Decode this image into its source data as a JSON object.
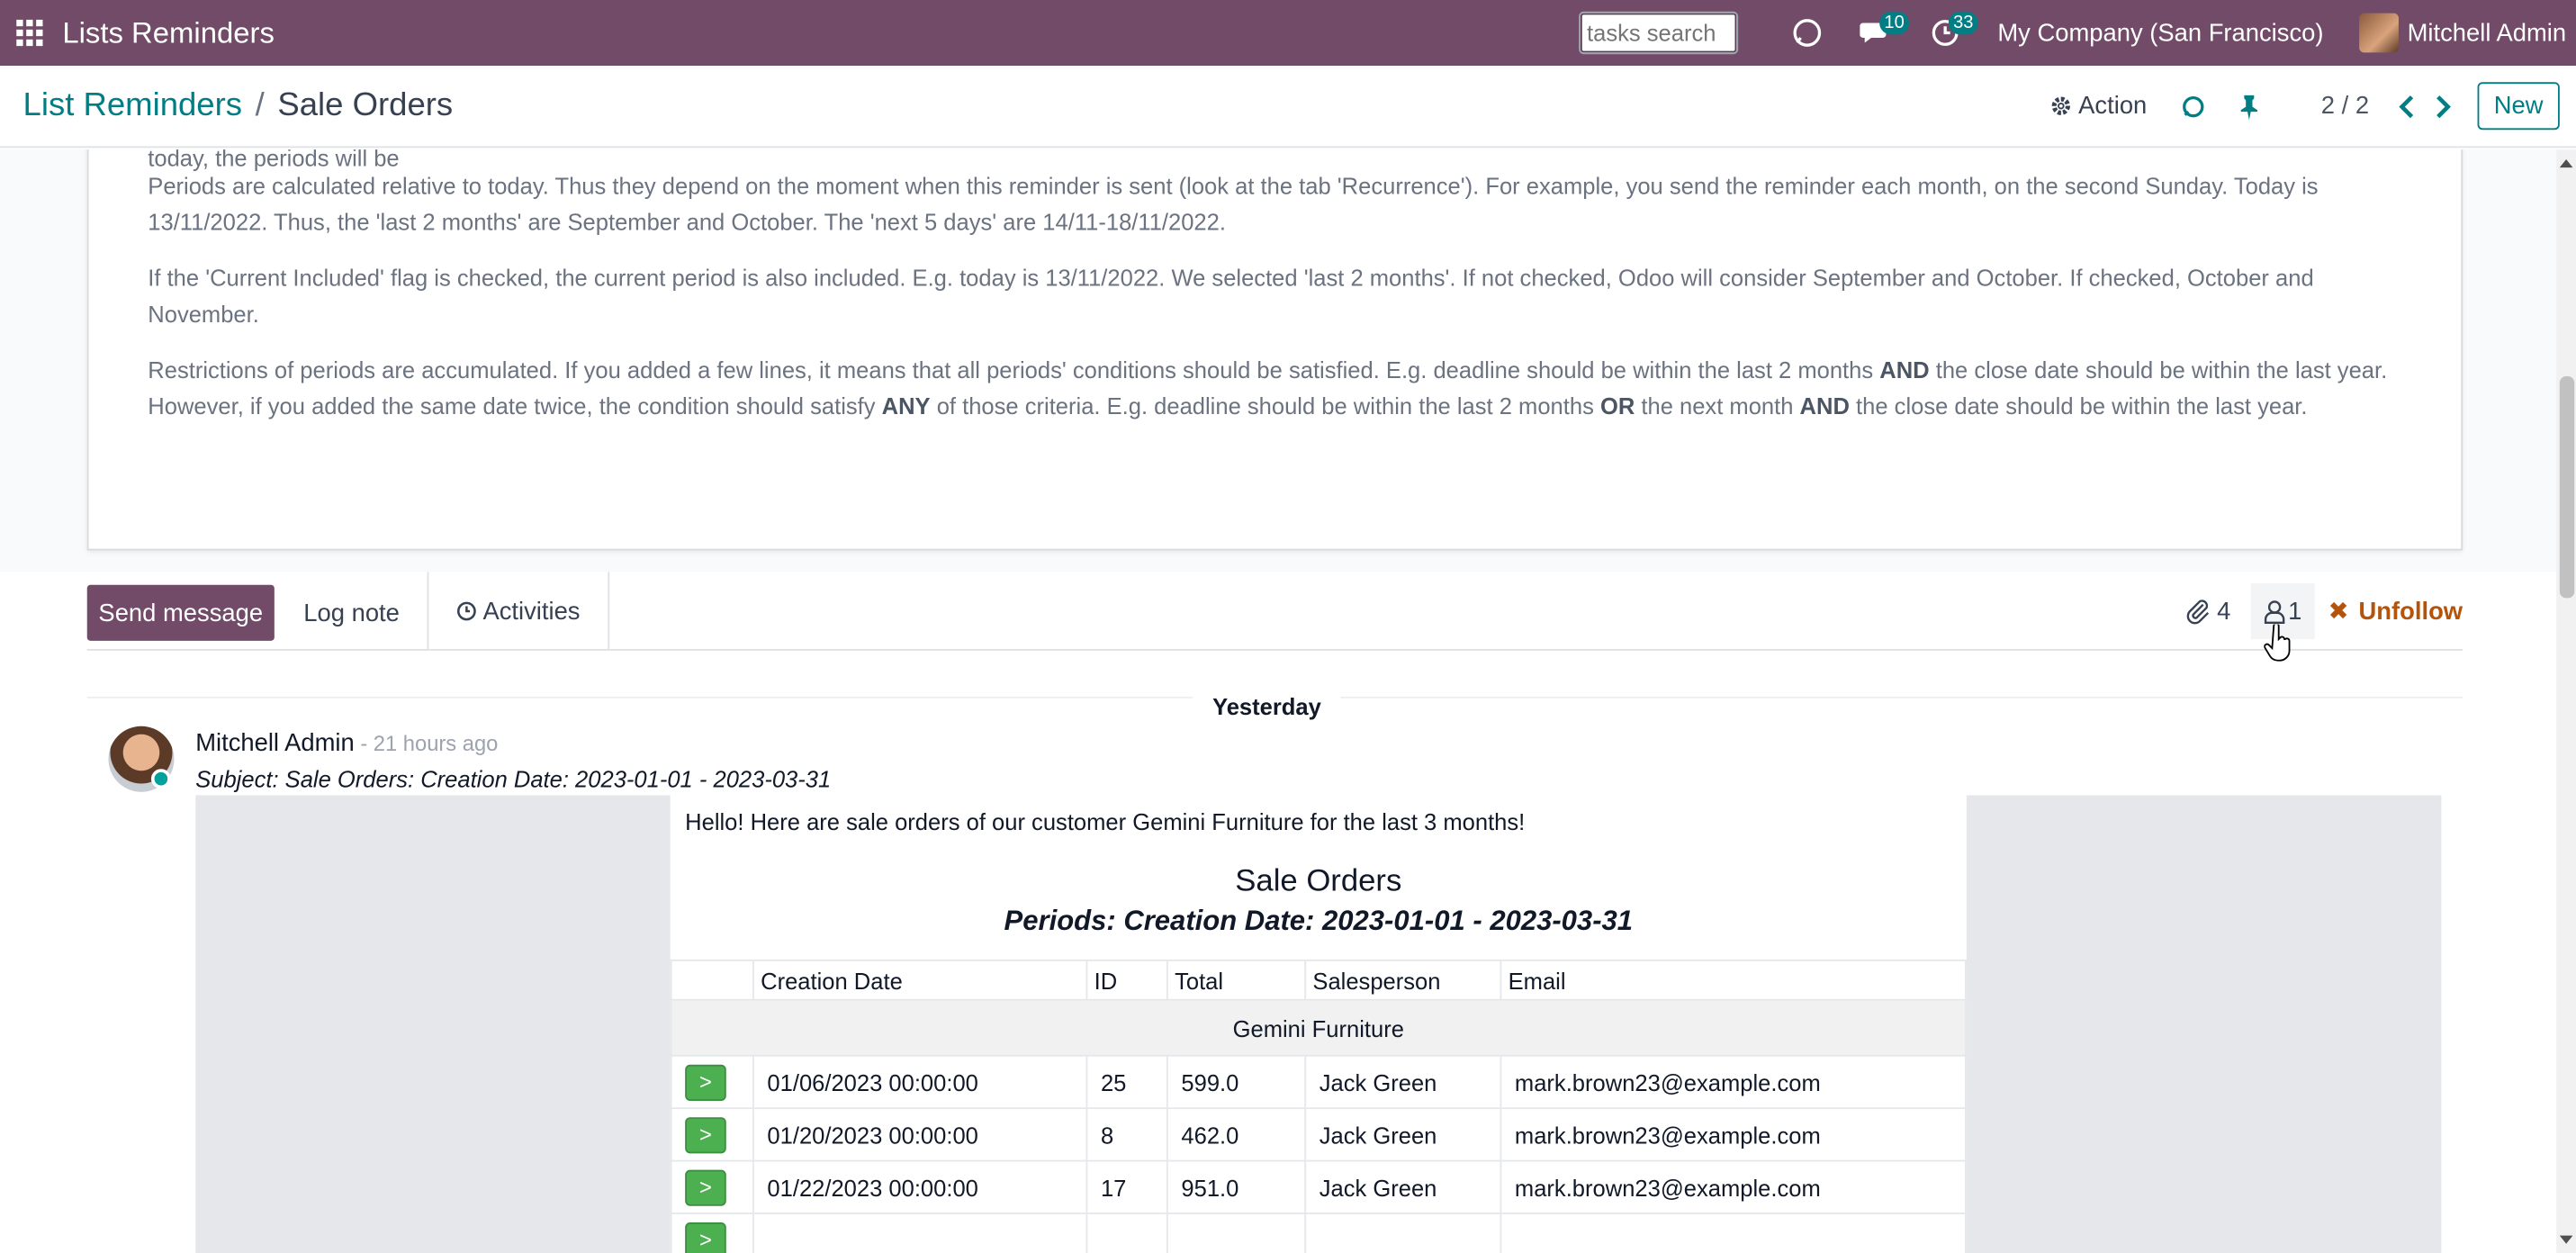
{
  "navbar": {
    "app_title": "Lists Reminders",
    "search_placeholder": "tasks search",
    "messages_count": "10",
    "activities_count": "33",
    "company": "My Company (San Francisco)",
    "user_name": "Mitchell Admin",
    "bg_color": "#714B67"
  },
  "control": {
    "breadcrumb_parent": "List Reminders",
    "breadcrumb_sep": "/",
    "breadcrumb_current": "Sale Orders",
    "action_label": "Action",
    "pager": "2 / 2",
    "new_label": "New",
    "accent_color": "#017e84"
  },
  "sheet": {
    "para0": "today, the periods will be",
    "para1": "Periods are calculated relative to today. Thus they depend on the moment when this reminder is sent (look at the tab 'Recurrence'). For example, you send the reminder each month, on the second Sunday. Today is 13/11/2022. Thus, the 'last 2 months' are September and October. The 'next 5 days' are 14/11-18/11/2022.",
    "para2": "If the 'Current Included' flag is checked, the current period is also included. E.g. today is 13/11/2022. We selected 'last 2 months'. If not checked, Odoo will consider September and October. If checked, October and November.",
    "para3_a": "Restrictions of periods are accumulated. If you added a few lines, it means that all periods' conditions should be satisfied. E.g. deadline should be within the last 2 months ",
    "para3_b": "AND",
    "para3_c": " the close date should be within the last year. However, if you added the same date twice, the condition should satisfy ",
    "para3_d": "ANY",
    "para3_e": " of those criteria. E.g. deadline should be within the last 2 months ",
    "para3_f": "OR",
    "para3_g": " the next month ",
    "para3_h": "AND",
    "para3_i": " the close date should be within the last year."
  },
  "chatter": {
    "send_message": "Send message",
    "log_note": "Log note",
    "activities": "Activities",
    "attachments_count": "4",
    "followers_count": "1",
    "unfollow": "Unfollow",
    "date_separator": "Yesterday"
  },
  "message": {
    "author": "Mitchell Admin",
    "time": " - 21 hours ago",
    "subject": "Subject: Sale Orders: Creation Date: 2023-01-01 - 2023-03-31",
    "greeting": "Hello! Here are sale orders of our customer Gemini Furniture for the last 3 months!",
    "title": "Sale Orders",
    "periods": "Periods: Creation Date: 2023-01-01 - 2023-03-31",
    "columns": [
      "",
      "Creation Date",
      "ID",
      "Total",
      "Salesperson",
      "Email"
    ],
    "group": "Gemini Furniture",
    "button_label": ">",
    "rows": [
      {
        "date": "01/06/2023 00:00:00",
        "id": "25",
        "total": "599.0",
        "salesperson": "Jack Green",
        "email": "mark.brown23@example.com"
      },
      {
        "date": "01/20/2023 00:00:00",
        "id": "8",
        "total": "462.0",
        "salesperson": "Jack Green",
        "email": "mark.brown23@example.com"
      },
      {
        "date": "01/22/2023 00:00:00",
        "id": "17",
        "total": "951.0",
        "salesperson": "Jack Green",
        "email": "mark.brown23@example.com"
      }
    ]
  }
}
